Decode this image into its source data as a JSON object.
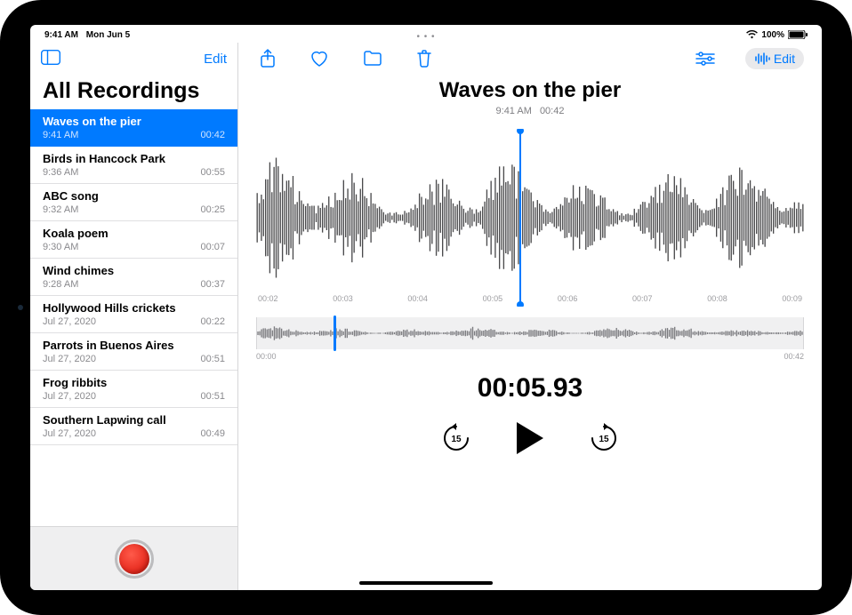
{
  "statusbar": {
    "time": "9:41 AM",
    "date": "Mon Jun 5",
    "battery": "100%"
  },
  "sidebar": {
    "edit_label": "Edit",
    "title": "All Recordings",
    "items": [
      {
        "title": "Waves on the pier",
        "time": "9:41 AM",
        "dur": "00:42",
        "selected": true
      },
      {
        "title": "Birds in Hancock Park",
        "time": "9:36 AM",
        "dur": "00:55"
      },
      {
        "title": "ABC song",
        "time": "9:32 AM",
        "dur": "00:25"
      },
      {
        "title": "Koala poem",
        "time": "9:30 AM",
        "dur": "00:07"
      },
      {
        "title": "Wind chimes",
        "time": "9:28 AM",
        "dur": "00:37"
      },
      {
        "title": "Hollywood Hills crickets",
        "time": "Jul 27, 2020",
        "dur": "00:22"
      },
      {
        "title": "Parrots in Buenos Aires",
        "time": "Jul 27, 2020",
        "dur": "00:51"
      },
      {
        "title": "Frog ribbits",
        "time": "Jul 27, 2020",
        "dur": "00:51"
      },
      {
        "title": "Southern Lapwing call",
        "time": "Jul 27, 2020",
        "dur": "00:49"
      }
    ]
  },
  "detail": {
    "title": "Waves on the pier",
    "subtime": "9:41 AM",
    "subdur": "00:42",
    "edit_label": "Edit",
    "timeline_ticks": [
      "00:02",
      "00:03",
      "00:04",
      "00:05",
      "00:06",
      "00:07",
      "00:08",
      "00:09"
    ],
    "mini_start": "00:00",
    "mini_end": "00:42",
    "timecode": "00:05.93",
    "skip_sec": "15"
  }
}
